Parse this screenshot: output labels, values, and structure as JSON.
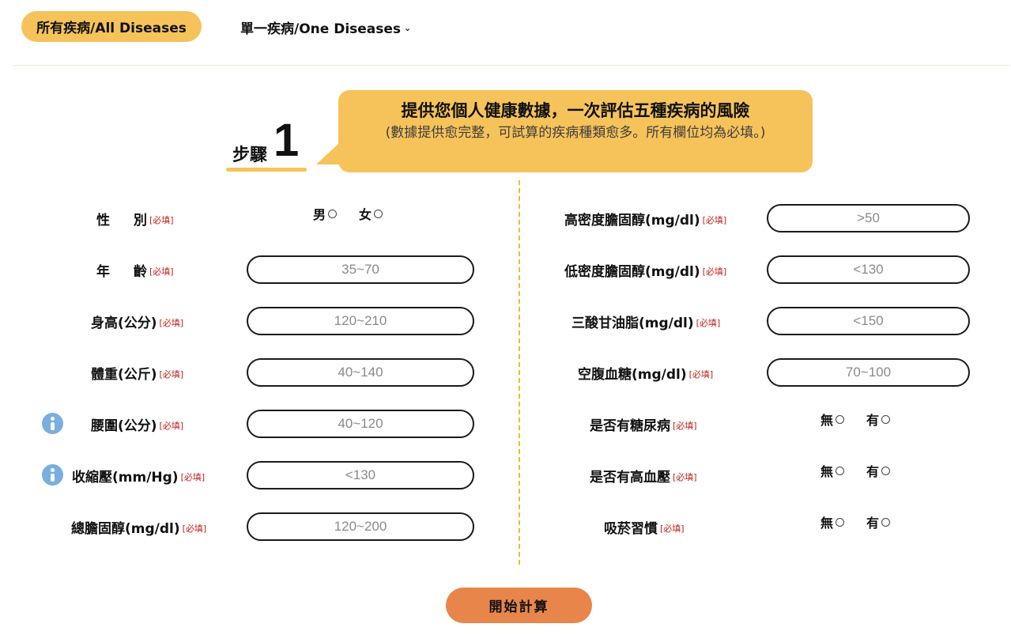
{
  "tabs": {
    "all": "所有疾病/All Diseases",
    "one": "單一疾病/One Diseases"
  },
  "step": {
    "label": "步驟",
    "number": "1"
  },
  "banner": {
    "title": "提供您個人健康數據，一次評估五種疾病的風險",
    "subtitle": "(數據提供愈完整，可試算的疾病種類愈多。所有欄位均為必填。)"
  },
  "required_tag": "[必填]",
  "left": {
    "sex": {
      "label_a": "性",
      "label_b": "別",
      "options": [
        "男",
        "女"
      ]
    },
    "age": {
      "label_a": "年",
      "label_b": "齡",
      "placeholder": "35~70"
    },
    "height": {
      "label": "身高(公分)",
      "placeholder": "120~210"
    },
    "weight": {
      "label": "體重(公斤)",
      "placeholder": "40~140"
    },
    "waist": {
      "label": "腰圍(公分)",
      "placeholder": "40~120"
    },
    "systolic": {
      "label": "收縮壓(mm/Hg)",
      "placeholder": "<130"
    },
    "cholesterol": {
      "label": "總膽固醇(mg/dl)",
      "placeholder": "120~200"
    }
  },
  "right": {
    "hdl": {
      "label": "高密度膽固醇(mg/dl)",
      "placeholder": ">50"
    },
    "ldl": {
      "label": "低密度膽固醇(mg/dl)",
      "placeholder": "<130"
    },
    "tg": {
      "label": "三酸甘油脂(mg/dl)",
      "placeholder": "<150"
    },
    "glucose": {
      "label": "空腹血糖(mg/dl)",
      "placeholder": "70~100"
    },
    "diabetes": {
      "label": "是否有糖尿病",
      "options": [
        "無",
        "有"
      ]
    },
    "hypertension": {
      "label": "是否有高血壓",
      "options": [
        "無",
        "有"
      ]
    },
    "smoking": {
      "label": "吸菸習慣",
      "options": [
        "無",
        "有"
      ]
    }
  },
  "submit_label": "開始計算",
  "colors": {
    "accent": "#f6c35a",
    "button": "#e8854a",
    "required": "#c0211a",
    "info": "#79aee0"
  },
  "icons": {
    "info": "info-icon",
    "chevron": "chevron-down-icon"
  }
}
